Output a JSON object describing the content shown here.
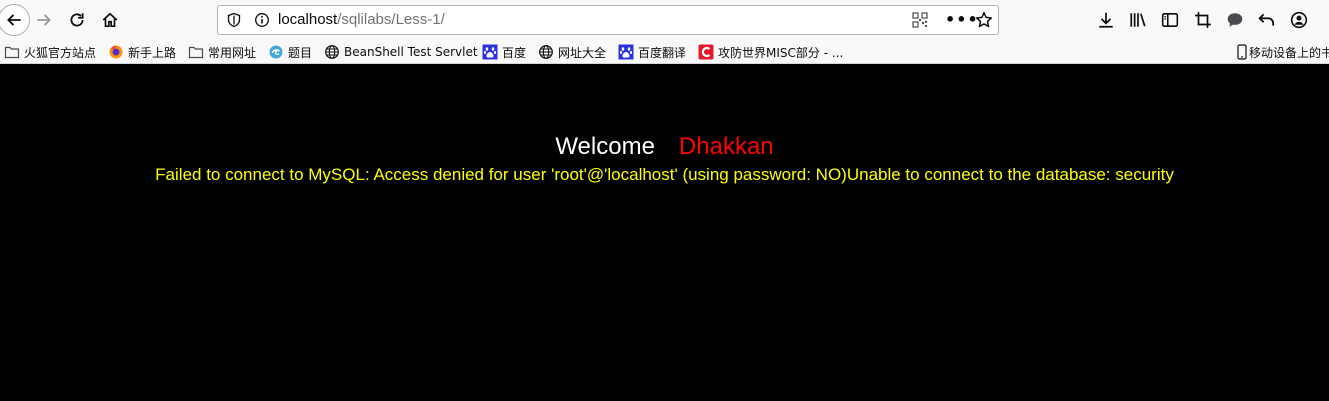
{
  "browser": {
    "url_host": "localhost",
    "url_path": "/sqlilabs/Less-1/"
  },
  "bookmarks": [
    {
      "label": "火狐官方站点",
      "icon": "folder-icon"
    },
    {
      "label": "新手上路",
      "icon": "firefox-icon"
    },
    {
      "label": "常用网址",
      "icon": "folder-icon"
    },
    {
      "label": "题目",
      "icon": "swirl-icon"
    },
    {
      "label": "BeanShell Test Servlet",
      "icon": "globe-icon"
    },
    {
      "label": "百度",
      "icon": "baidu-paw-icon"
    },
    {
      "label": "网址大全",
      "icon": "globe-icon"
    },
    {
      "label": "百度翻译",
      "icon": "baidu-paw-icon"
    },
    {
      "label": "攻防世界MISC部分 - ...",
      "icon": "c-logo-icon"
    },
    {
      "label": "移动设备上的书",
      "icon": "mobile-icon"
    }
  ],
  "page": {
    "welcome": "Welcome",
    "name": "Dhakkan",
    "error": "Failed to connect to MySQL: Access denied for user 'root'@'localhost' (using password: NO)Unable to connect to the database: security"
  },
  "colors": {
    "background": "#000000",
    "welcome": "#ffffff",
    "name": "#ff0000",
    "error": "#ffff00"
  }
}
